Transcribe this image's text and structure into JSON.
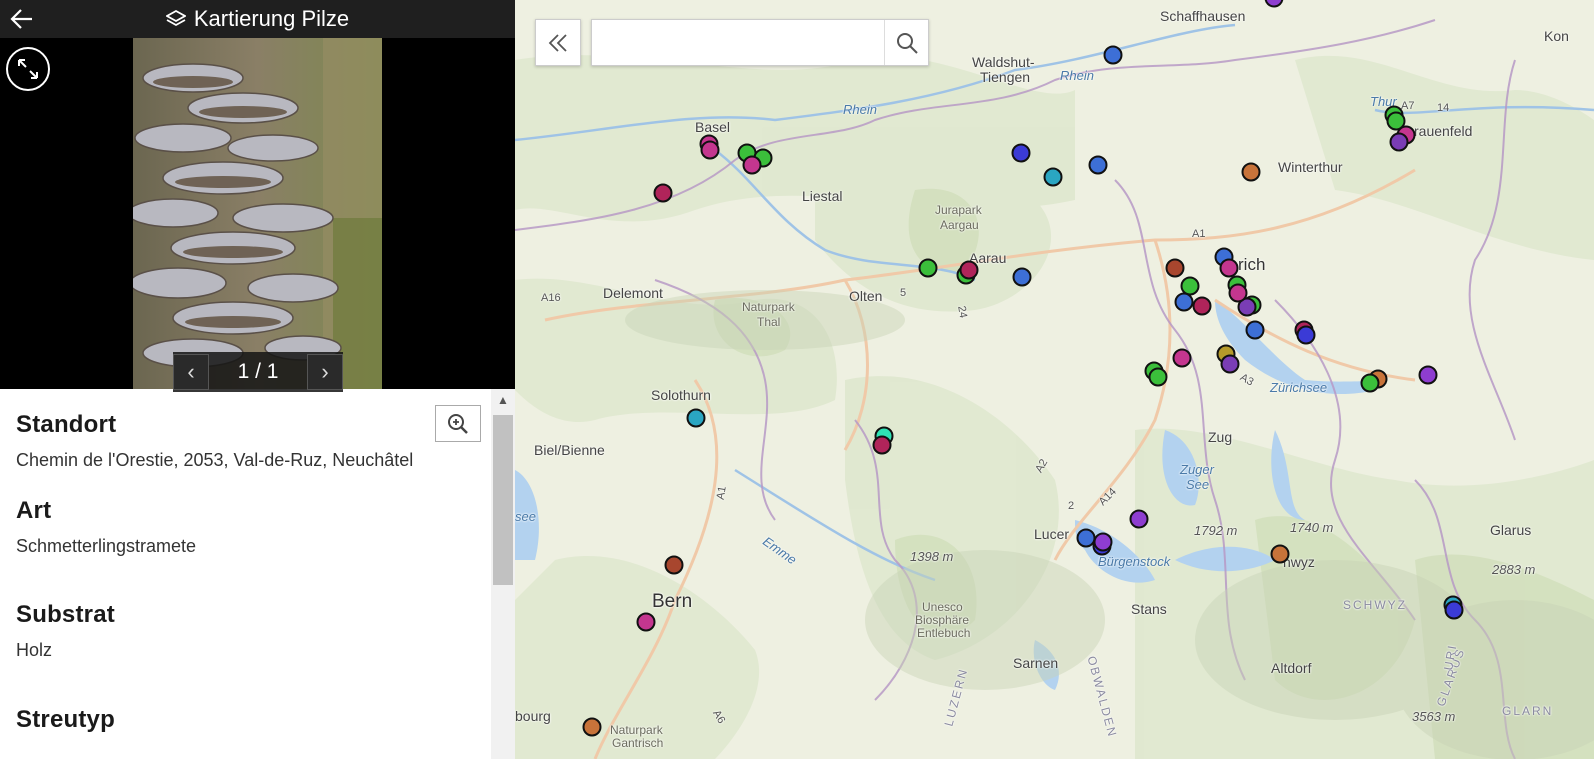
{
  "header": {
    "title": "Kartierung Pilze"
  },
  "pager": {
    "count": "1 / 1"
  },
  "details": {
    "fields": [
      {
        "label": "Standort",
        "value": "Chemin de l'Orestie, 2053, Val-de-Ruz, Neuchâtel"
      },
      {
        "label": "Art",
        "value": "Schmetterlingstramete"
      },
      {
        "label": "Substrat",
        "value": "Holz"
      },
      {
        "label": "Streutyp",
        "value": ""
      }
    ]
  },
  "search": {
    "value": "",
    "placeholder": ""
  },
  "map": {
    "places": {
      "schaffhausen": "Schaffhausen",
      "waldshut": "Waldshut-",
      "tiengen": "Tiengen",
      "kon": "Kon",
      "basel": "Basel",
      "rhein1": "Rhein",
      "rhein2": "Rhein",
      "liestal": "Liestal",
      "winterthur": "Winterthur",
      "frauenfeld": "rauenfeld",
      "thur": "Thur",
      "jurapark1": "Jurapark",
      "jurapark2": "Aargau",
      "aarau": "Aarau",
      "zurich": "rich",
      "delemont": "Delemont",
      "olten": "Olten",
      "naturpark1": "Naturpark",
      "naturpark2": "Thal",
      "solothurn": "Solothurn",
      "zurichsee": "Zürichsee",
      "zug": "Zug",
      "zugersee1": "Zuger",
      "zugersee2": "See",
      "biel": "Biel/Bienne",
      "see": "see",
      "lucerne": "Lucer",
      "buergenstock": "Bürgenstock",
      "elev1792": "1792 m",
      "elev1740": "1740 m",
      "glarus": "Glarus",
      "elev2883": "2883 m",
      "schwyz": "hwyz",
      "schwyz_region": "SCHWYZ",
      "elev1398": "1398 m",
      "bern": "Bern",
      "emme": "Emme",
      "unesco1": "Unesco",
      "unesco2": "Biosphäre",
      "unesco3": "Entlebuch",
      "stans": "Stans",
      "sarnen": "Sarnen",
      "altdorf": "Altdorf",
      "luzern_region": "LUZERN",
      "obwalden_region": "OBWALDEN",
      "glarus_region": "GLARUS",
      "uri_region": "URI",
      "fribourg": "bourg",
      "gantrisch1": "Naturpark",
      "gantrisch2": "Gantrisch",
      "elev3563": "3563 m",
      "glarn": "GLARN",
      "a1": "A1",
      "a1b": "A1",
      "a2": "A2",
      "a3": "A3",
      "a7": "A7",
      "a14": "A14",
      "a16": "A16",
      "a6": "A6",
      "n14": "14",
      "n5": "5",
      "n24": "24",
      "n2": "2"
    },
    "marker_colors": {
      "magenta": "#c4368f",
      "crimson": "#b0245a",
      "green": "#3bbf3b",
      "teal": "#2aa6c2",
      "blue": "#3d6fd6",
      "purple": "#7a3db5",
      "orange": "#c8733a",
      "violet": "#8e3dd0",
      "darkred": "#a8462e",
      "mint": "#2ee3b4",
      "olive": "#b59a2a",
      "indigo": "#3b3bd6"
    }
  }
}
